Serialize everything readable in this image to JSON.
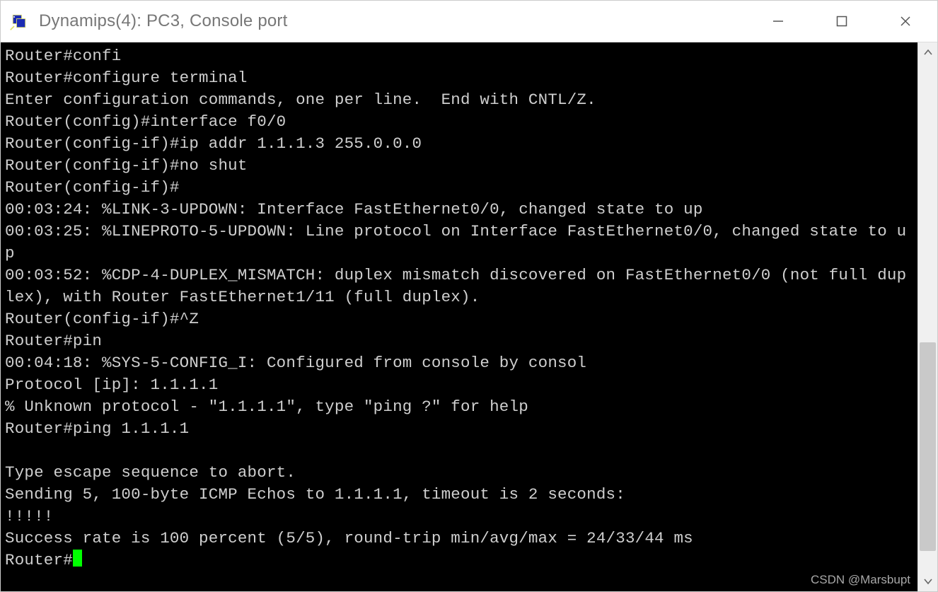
{
  "window": {
    "title": "Dynamips(4): PC3, Console port",
    "icon_name": "putty-icon"
  },
  "controls": {
    "minimize": "minimize",
    "maximize": "maximize",
    "close": "close"
  },
  "terminal": {
    "lines": [
      "Router#confi",
      "Router#configure terminal",
      "Enter configuration commands, one per line.  End with CNTL/Z.",
      "Router(config)#interface f0/0",
      "Router(config-if)#ip addr 1.1.1.3 255.0.0.0",
      "Router(config-if)#no shut",
      "Router(config-if)#",
      "00:03:24: %LINK-3-UPDOWN: Interface FastEthernet0/0, changed state to up",
      "00:03:25: %LINEPROTO-5-UPDOWN: Line protocol on Interface FastEthernet0/0, changed state to up",
      "00:03:52: %CDP-4-DUPLEX_MISMATCH: duplex mismatch discovered on FastEthernet0/0 (not full duplex), with Router FastEthernet1/11 (full duplex).",
      "Router(config-if)#^Z",
      "Router#pin",
      "00:04:18: %SYS-5-CONFIG_I: Configured from console by consol",
      "Protocol [ip]: 1.1.1.1",
      "% Unknown protocol - \"1.1.1.1\", type \"ping ?\" for help",
      "Router#ping 1.1.1.1",
      "",
      "Type escape sequence to abort.",
      "Sending 5, 100-byte ICMP Echos to 1.1.1.1, timeout is 2 seconds:",
      "!!!!!",
      "Success rate is 100 percent (5/5), round-trip min/avg/max = 24/33/44 ms",
      "Router#"
    ],
    "prompt_has_cursor": true
  },
  "scrollbar": {
    "thumb_top_pct": 55,
    "thumb_height_pct": 41
  },
  "watermark": "CSDN @Marsbupt"
}
